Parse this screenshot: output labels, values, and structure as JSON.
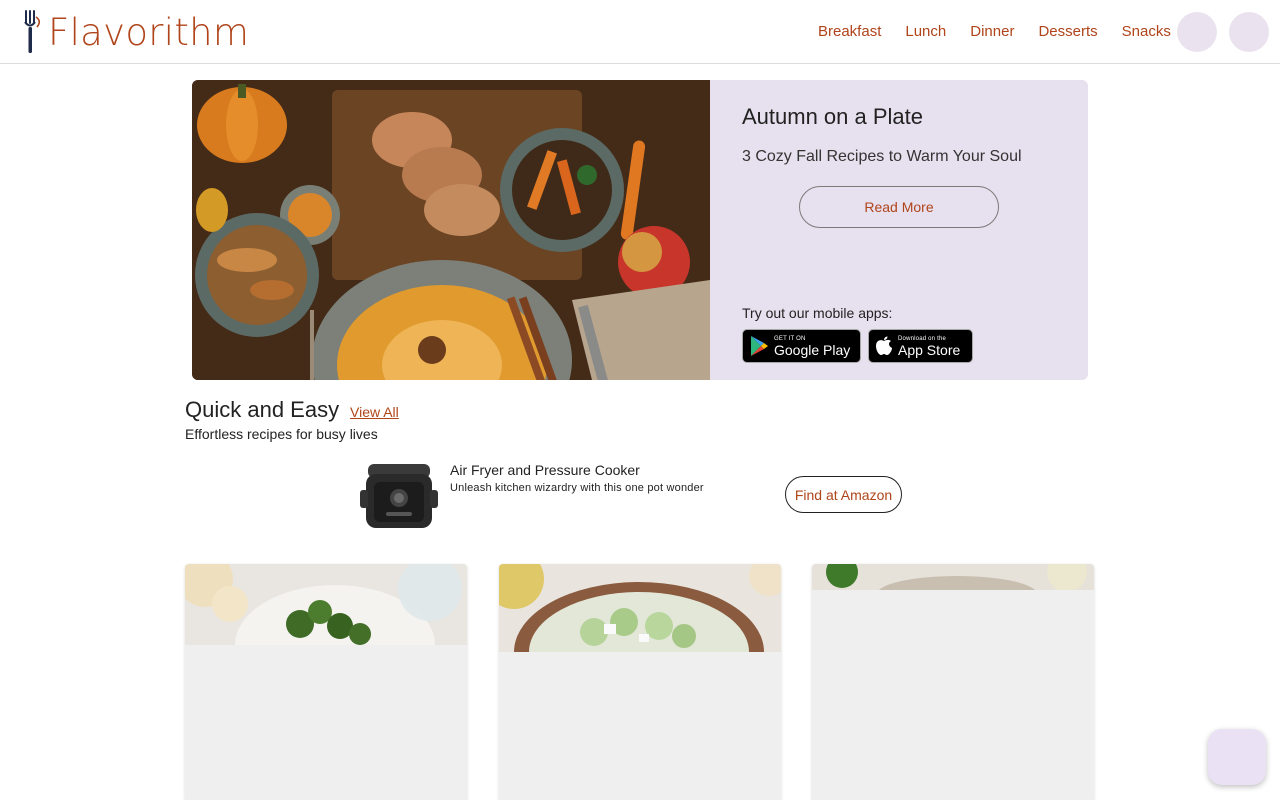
{
  "header": {
    "logo_text": "Flavorithm",
    "nav": [
      "Breakfast",
      "Lunch",
      "Dinner",
      "Desserts",
      "Snacks"
    ]
  },
  "hero": {
    "title": "Autumn on a Plate",
    "subtitle": "3 Cozy Fall Recipes to Warm Your Soul",
    "cta_label": "Read More",
    "apps_label": "Try out our mobile apps:",
    "google_play": {
      "small": "GET IT ON",
      "big": "Google Play"
    },
    "app_store": {
      "small": "Download on the",
      "big": "App Store"
    }
  },
  "section": {
    "title": "Quick and Easy",
    "view_all": "View All",
    "subtitle": "Effortless recipes for busy lives"
  },
  "ad": {
    "title": "Air Fryer and Pressure Cooker",
    "subtitle": "Unleash kitchen wizardry with this one pot wonder",
    "cta_label": "Find at Amazon"
  },
  "colors": {
    "brand": "#b0441a",
    "hero_panel": "#e7e0ee",
    "icon_button": "#ebe2ef",
    "card_placeholder": "#efefef"
  }
}
